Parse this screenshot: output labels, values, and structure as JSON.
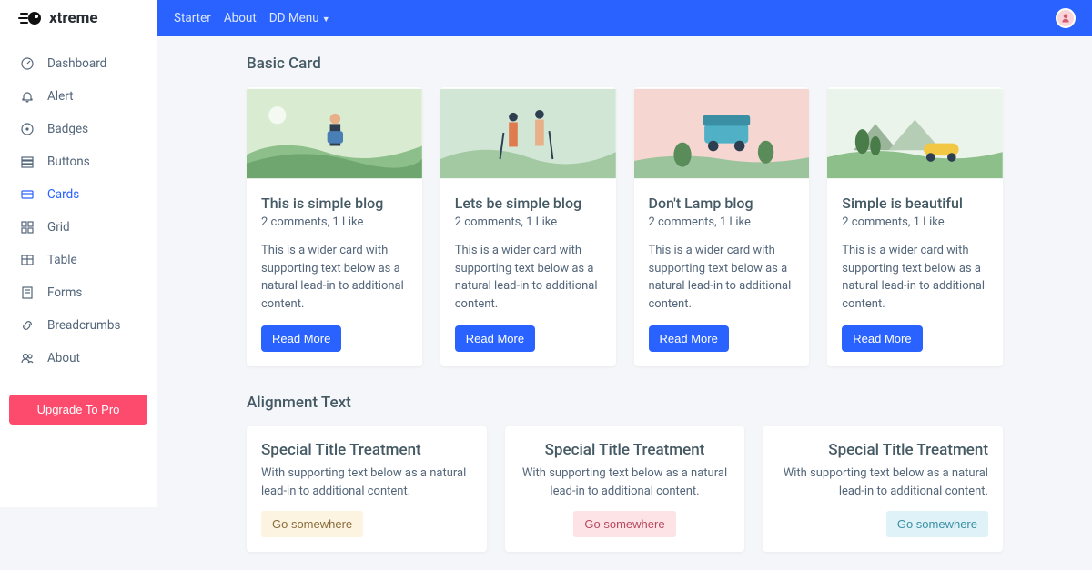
{
  "brand": {
    "name": "xtreme"
  },
  "topnav": {
    "items": [
      "Starter",
      "About",
      "DD Menu"
    ]
  },
  "sidebar": {
    "items": [
      {
        "label": "Dashboard",
        "icon": "gauge-icon"
      },
      {
        "label": "Alert",
        "icon": "bell-icon"
      },
      {
        "label": "Badges",
        "icon": "tag-icon"
      },
      {
        "label": "Buttons",
        "icon": "stack-icon"
      },
      {
        "label": "Cards",
        "icon": "card-icon",
        "active": true
      },
      {
        "label": "Grid",
        "icon": "grid-icon"
      },
      {
        "label": "Table",
        "icon": "table-icon"
      },
      {
        "label": "Forms",
        "icon": "form-icon"
      },
      {
        "label": "Breadcrumbs",
        "icon": "link-icon"
      },
      {
        "label": "About",
        "icon": "users-icon"
      }
    ],
    "upgrade": "Upgrade To Pro"
  },
  "sections": {
    "basic_card": "Basic Card",
    "alignment_text": "Alignment Text"
  },
  "cards": [
    {
      "title": "This is simple blog",
      "meta": "2 comments, 1 Like",
      "text": "This is a wider card with supporting text below as a natural lead-in to additional content.",
      "button": "Read More",
      "bg": "#d9ebd1"
    },
    {
      "title": "Lets be simple blog",
      "meta": "2 comments, 1 Like",
      "text": "This is a wider card with supporting text below as a natural lead-in to additional content.",
      "button": "Read More",
      "bg": "#d2e6d6"
    },
    {
      "title": "Don't Lamp blog",
      "meta": "2 comments, 1 Like",
      "text": "This is a wider card with supporting text below as a natural lead-in to additional content.",
      "button": "Read More",
      "bg": "#f5d6d1"
    },
    {
      "title": "Simple is beautiful",
      "meta": "2 comments, 1 Like",
      "text": "This is a wider card with supporting text below as a natural lead-in to additional content.",
      "button": "Read More",
      "bg": "#eaf4ea"
    }
  ],
  "alignment_cards": [
    {
      "title": "Special Title Treatment",
      "text": "With supporting text below as a natural lead-in to additional content.",
      "button": "Go somewhere",
      "align": "left",
      "btn_class": "btn-warning-light"
    },
    {
      "title": "Special Title Treatment",
      "text": "With supporting text below as a natural lead-in to additional content.",
      "button": "Go somewhere",
      "align": "center",
      "btn_class": "btn-danger-light"
    },
    {
      "title": "Special Title Treatment",
      "text": "With supporting text below as a natural lead-in to additional content.",
      "button": "Go somewhere",
      "align": "right",
      "btn_class": "btn-info-light"
    }
  ]
}
